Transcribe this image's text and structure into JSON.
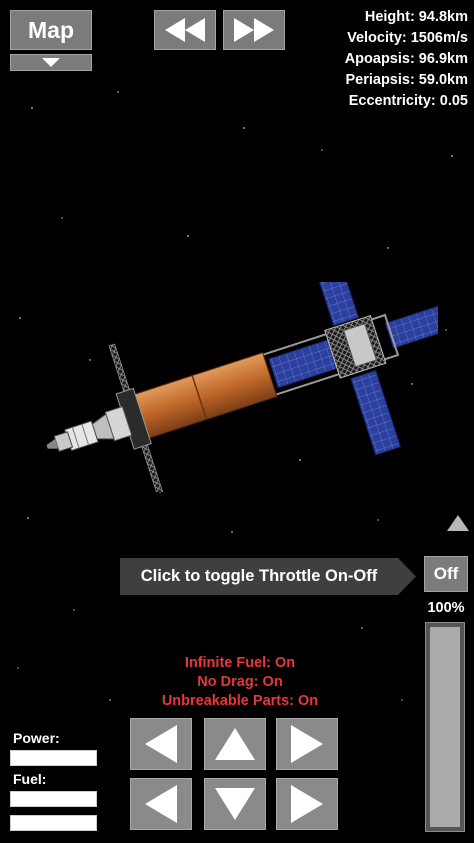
{
  "nav": {
    "map_label": "Map"
  },
  "telemetry": [
    {
      "label": "Height",
      "value": "94.8km"
    },
    {
      "label": "Velocity",
      "value": "1506m/s"
    },
    {
      "label": "Apoapsis",
      "value": "96.9km"
    },
    {
      "label": "Periapsis",
      "value": "59.0km"
    },
    {
      "label": "Eccentricity",
      "value": "0.05"
    }
  ],
  "telemetry_text": [
    "Height: 94.8km",
    "Velocity: 1506m/s",
    "Apoapsis: 96.9km",
    "Periapsis: 59.0km",
    "Eccentricity: 0.05"
  ],
  "throttle": {
    "hint": "Click to toggle Throttle On-Off",
    "toggle_label": "Off",
    "percent_label": "100%",
    "level": 1.0
  },
  "cheats": {
    "infinite_fuel": "Infinite Fuel: On",
    "no_drag": "No Drag: On",
    "unbreakable_parts": "Unbreakable Parts: On"
  },
  "gauges": {
    "power_label": "Power:",
    "fuel_label": "Fuel:"
  },
  "colors": {
    "button_bg": "#7b7b7b",
    "cheat_text": "#e8373a",
    "fuel_tank": "#c0672a",
    "solar_panel": "#2b3f9e"
  },
  "icons": {
    "map_toggle": "triangle-down-icon",
    "warp_slower": "rewind-icon",
    "warp_faster": "fast-forward-icon",
    "expand": "triangle-up-icon",
    "controls": [
      "arrow-left-icon",
      "arrow-up-icon",
      "arrow-right-icon",
      "arrow-left-icon",
      "arrow-down-icon",
      "arrow-right-icon"
    ]
  }
}
